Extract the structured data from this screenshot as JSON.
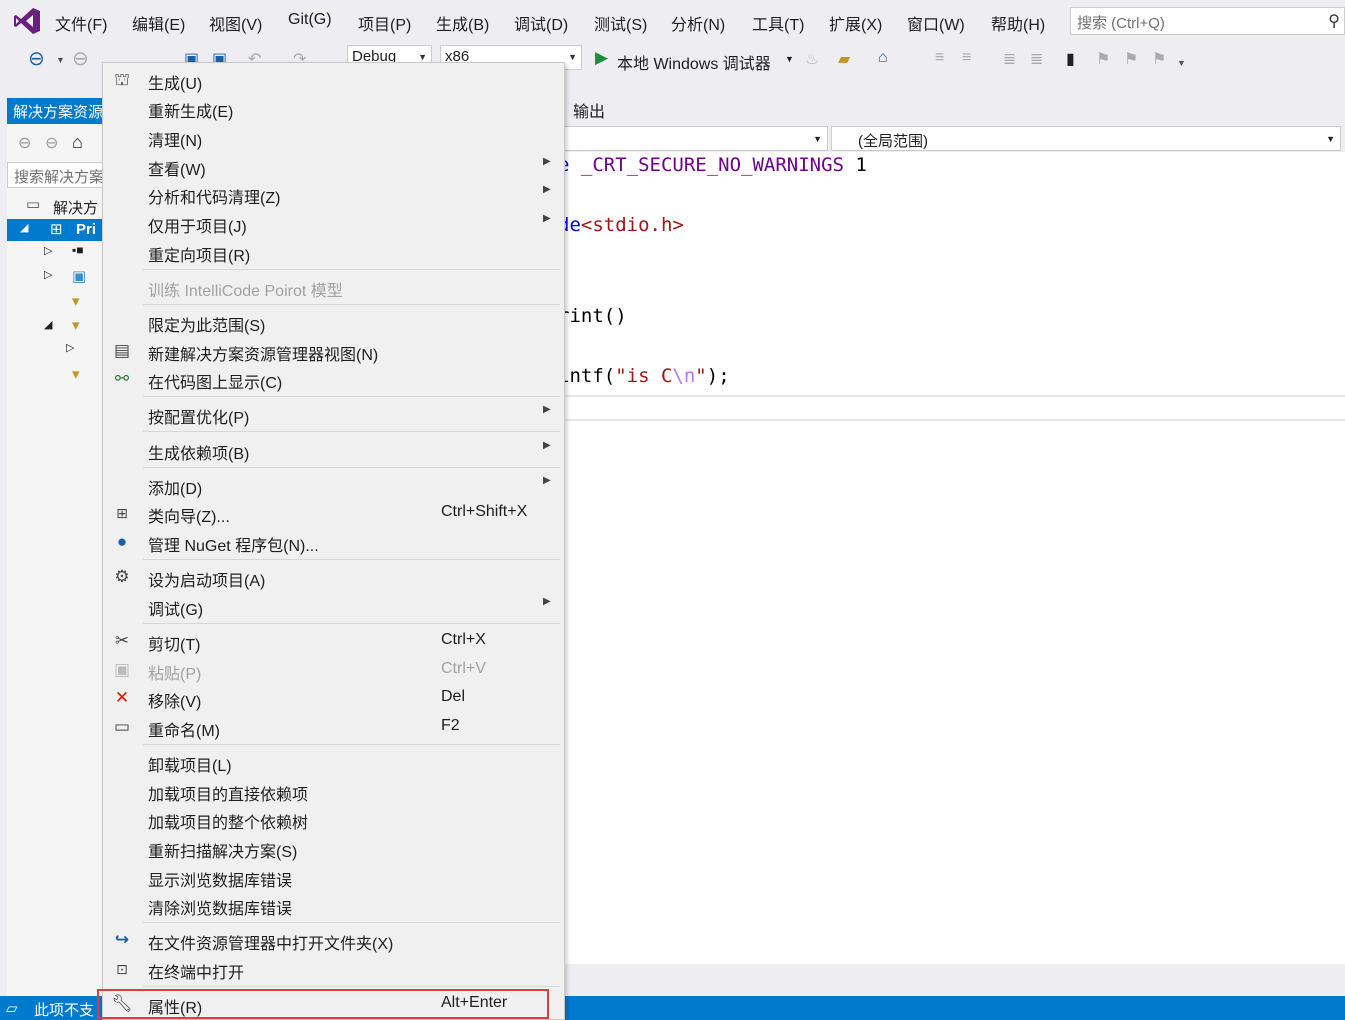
{
  "menubar": {
    "items": [
      "文件(F)",
      "编辑(E)",
      "视图(V)",
      "Git(G)",
      "项目(P)",
      "生成(B)",
      "调试(D)",
      "测试(S)",
      "分析(N)",
      "工具(T)",
      "扩展(X)",
      "窗口(W)",
      "帮助(H)"
    ],
    "search_placeholder": "搜索 (Ctrl+Q)"
  },
  "toolbar": {
    "configuration": "Debug",
    "platform": "x86",
    "run_label": "本地 Windows 调试器"
  },
  "solution_explorer": {
    "tab_title": "解决方案资源管理器",
    "search_placeholder": "搜索解决方案",
    "solution_label": "解决方",
    "project_label": "Pri"
  },
  "editor": {
    "output_tab": "输出",
    "scope": "(全局范围)",
    "code": {
      "l1_kw": "e ",
      "l1_macro": "_CRT_SECURE_NO_WARNINGS",
      "l1_num": " 1",
      "l2_kw": "de",
      "l2_inc": "<stdio.h>",
      "l3": "rint()",
      "l4_fn": "intf(",
      "l4_str1": "\"is C",
      "l4_esc": "\\n",
      "l4_str2": "\"",
      "l4_end": ");"
    }
  },
  "status": {
    "text": "此项不支"
  },
  "context_menu": {
    "items": [
      {
        "label": "生成(U)",
        "icon": "build-icon"
      },
      {
        "label": "重新生成(E)"
      },
      {
        "label": "清理(N)"
      },
      {
        "label": "查看(W)",
        "submenu": true
      },
      {
        "label": "分析和代码清理(Z)",
        "submenu": true
      },
      {
        "label": "仅用于项目(J)",
        "submenu": true
      },
      {
        "label": "重定向项目(R)"
      },
      {
        "label": "训练 IntelliCode Poirot 模型",
        "disabled": true
      },
      {
        "label": "限定为此范围(S)"
      },
      {
        "label": "新建解决方案资源管理器视图(N)",
        "icon": "new-view-icon"
      },
      {
        "label": "在代码图上显示(C)",
        "icon": "code-map-icon"
      },
      {
        "label": "按配置优化(P)",
        "submenu": true
      },
      {
        "label": "生成依赖项(B)",
        "submenu": true
      },
      {
        "label": "添加(D)",
        "submenu": true
      },
      {
        "label": "类向导(Z)...",
        "shortcut": "Ctrl+Shift+X",
        "icon": "class-wizard-icon"
      },
      {
        "label": "管理 NuGet 程序包(N)...",
        "icon": "nuget-icon"
      },
      {
        "label": "设为启动项目(A)",
        "icon": "gear-icon"
      },
      {
        "label": "调试(G)",
        "submenu": true
      },
      {
        "label": "剪切(T)",
        "shortcut": "Ctrl+X",
        "icon": "scissors-icon"
      },
      {
        "label": "粘贴(P)",
        "shortcut": "Ctrl+V",
        "disabled": true,
        "icon": "paste-icon"
      },
      {
        "label": "移除(V)",
        "shortcut": "Del",
        "icon": "remove-icon"
      },
      {
        "label": "重命名(M)",
        "shortcut": "F2",
        "icon": "rename-icon"
      },
      {
        "label": "卸载项目(L)"
      },
      {
        "label": "加载项目的直接依赖项"
      },
      {
        "label": "加载项目的整个依赖树"
      },
      {
        "label": "重新扫描解决方案(S)"
      },
      {
        "label": "显示浏览数据库错误"
      },
      {
        "label": "清除浏览数据库错误"
      },
      {
        "label": "在文件资源管理器中打开文件夹(X)",
        "icon": "open-folder-icon"
      },
      {
        "label": "在终端中打开",
        "icon": "terminal-icon"
      },
      {
        "label": "属性(R)",
        "shortcut": "Alt+Enter",
        "icon": "wrench-icon",
        "highlighted": true
      }
    ]
  },
  "colors": {
    "accent": "#007acc",
    "vs_purple": "#68217a",
    "highlight_border": "#e03c3c",
    "remove_red": "#e51400",
    "code_macro": "#6f008a",
    "code_string": "#a31515",
    "code_keyword": "#0000ff"
  }
}
